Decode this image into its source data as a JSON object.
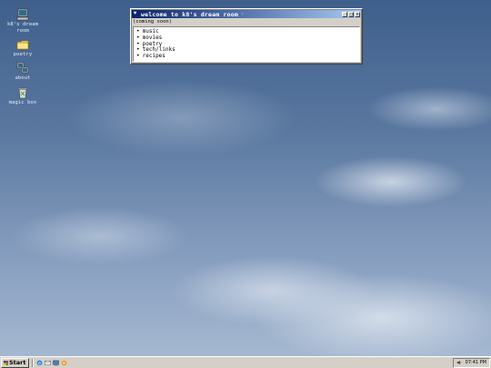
{
  "desktop": {
    "icons": [
      {
        "label": "k8's dream room",
        "icon": "computer-icon"
      },
      {
        "label": "poetry",
        "icon": "folder-icon"
      },
      {
        "label": "about",
        "icon": "network-icon"
      },
      {
        "label": "magic box",
        "icon": "recycle-bin-icon"
      }
    ]
  },
  "window": {
    "title": "welcome to k8's dream room",
    "title_ornament_left": "♥",
    "title_ornament_right": "♡",
    "controls": {
      "minimize": "_",
      "maximize": "□",
      "close": "×"
    },
    "status": "(coming soon)",
    "bullet": "•",
    "items": [
      "music",
      "movies",
      "poetry",
      "tech/links",
      "recipes"
    ]
  },
  "taskbar": {
    "start_label": "Start",
    "quick_launch": [
      "ie-icon",
      "outlook-icon",
      "desktop-icon",
      "media-icon"
    ],
    "clock": "07:41 PM",
    "tray_icon": "volume-icon"
  },
  "colors": {
    "titlebar_start": "#0a246a",
    "titlebar_end": "#a6caf0",
    "chrome": "#d4d0c8"
  }
}
